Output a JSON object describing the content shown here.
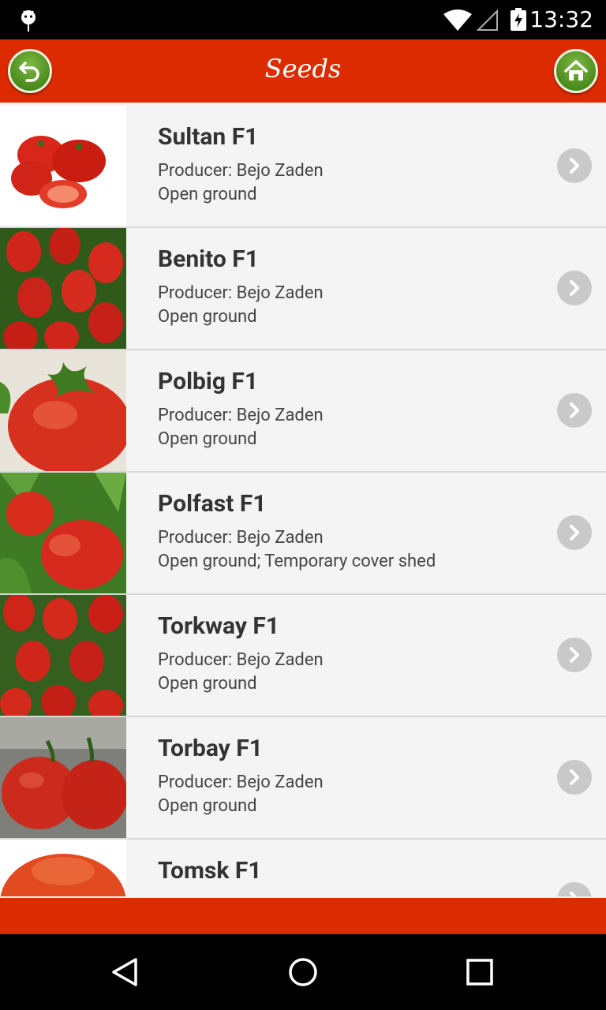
{
  "status": {
    "time": "13:32"
  },
  "header": {
    "title": "Seeds"
  },
  "seeds": [
    {
      "name": "Sultan F1",
      "producer": "Producer: Bejo Zaden",
      "ground": "Open ground",
      "variant": "round"
    },
    {
      "name": "Benito F1",
      "producer": "Producer: Bejo Zaden",
      "ground": "Open ground",
      "variant": "plum"
    },
    {
      "name": "Polbig F1",
      "producer": "Producer: Bejo Zaden",
      "ground": "Open ground",
      "variant": "big"
    },
    {
      "name": "Polfast F1",
      "producer": "Producer: Bejo Zaden",
      "ground": "Open ground; Temporary cover shed",
      "variant": "leafy"
    },
    {
      "name": "Torkway F1",
      "producer": "Producer: Bejo Zaden",
      "ground": "Open ground",
      "variant": "plum"
    },
    {
      "name": "Torbay F1",
      "producer": "Producer: Bejo Zaden",
      "ground": "Open ground",
      "variant": "vine"
    },
    {
      "name": "Tomsk F1",
      "producer": "",
      "ground": "",
      "variant": "cut"
    }
  ],
  "icons": {
    "back": "back-arrow-icon",
    "home": "home-icon",
    "chevron": "chevron-right-icon"
  },
  "colors": {
    "accent": "#dd2b00",
    "button_green": "#4e8e1f"
  }
}
